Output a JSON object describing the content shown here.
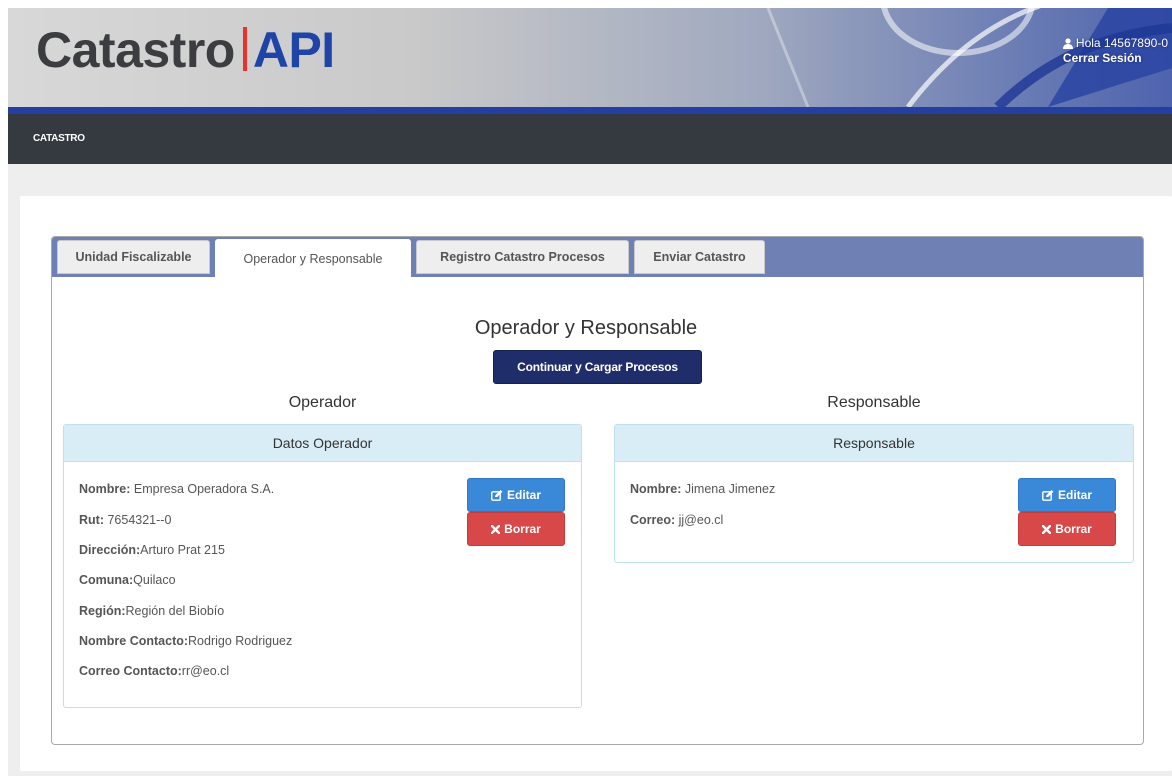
{
  "header": {
    "brand_word1": "Catastro",
    "brand_word2": "API",
    "greeting": "Hola 14567890-0",
    "logout": "Cerrar Sesión"
  },
  "nav": {
    "item": "CATASTRO"
  },
  "tabs": [
    {
      "label": "Unidad Fiscalizable",
      "active": false
    },
    {
      "label": "Operador y Responsable",
      "active": true
    },
    {
      "label": "Registro Catastro Procesos",
      "active": false
    },
    {
      "label": "Enviar Catastro",
      "active": false
    }
  ],
  "main": {
    "title": "Operador y Responsable",
    "continue_button": "Continuar y Cargar Procesos"
  },
  "operador": {
    "column_title": "Operador",
    "card_title": "Datos Operador",
    "fields": [
      {
        "label": "Nombre:",
        "value": " Empresa Operadora S.A."
      },
      {
        "label": "Rut:",
        "value": " 7654321--0"
      },
      {
        "label": "Dirección:",
        "value": "Arturo Prat 215"
      },
      {
        "label": "Comuna:",
        "value": "Quilaco"
      },
      {
        "label": "Región:",
        "value": "Región del Biobío"
      },
      {
        "label": "Nombre Contacto:",
        "value": "Rodrigo Rodriguez"
      },
      {
        "label": "Correo Contacto:",
        "value": "rr@eo.cl"
      }
    ],
    "edit_label": "Editar",
    "delete_label": "Borrar"
  },
  "responsable": {
    "column_title": "Responsable",
    "card_title": "Responsable",
    "fields": [
      {
        "label": "Nombre:",
        "value": " Jimena Jimenez"
      },
      {
        "label": "Correo:",
        "value": " jj@eo.cl"
      }
    ],
    "edit_label": "Editar",
    "delete_label": "Borrar"
  },
  "colors": {
    "header_dark": "#343a40",
    "brand_blue": "#1f44a8",
    "brand_red": "#e8322c",
    "tabbar": "#6f80b5",
    "primary": "#1f2d6b",
    "edit": "#3a89d8",
    "delete": "#d84848",
    "card_head": "#d9edf7"
  },
  "icons": [
    "user-icon",
    "edit-icon",
    "times-icon"
  ]
}
